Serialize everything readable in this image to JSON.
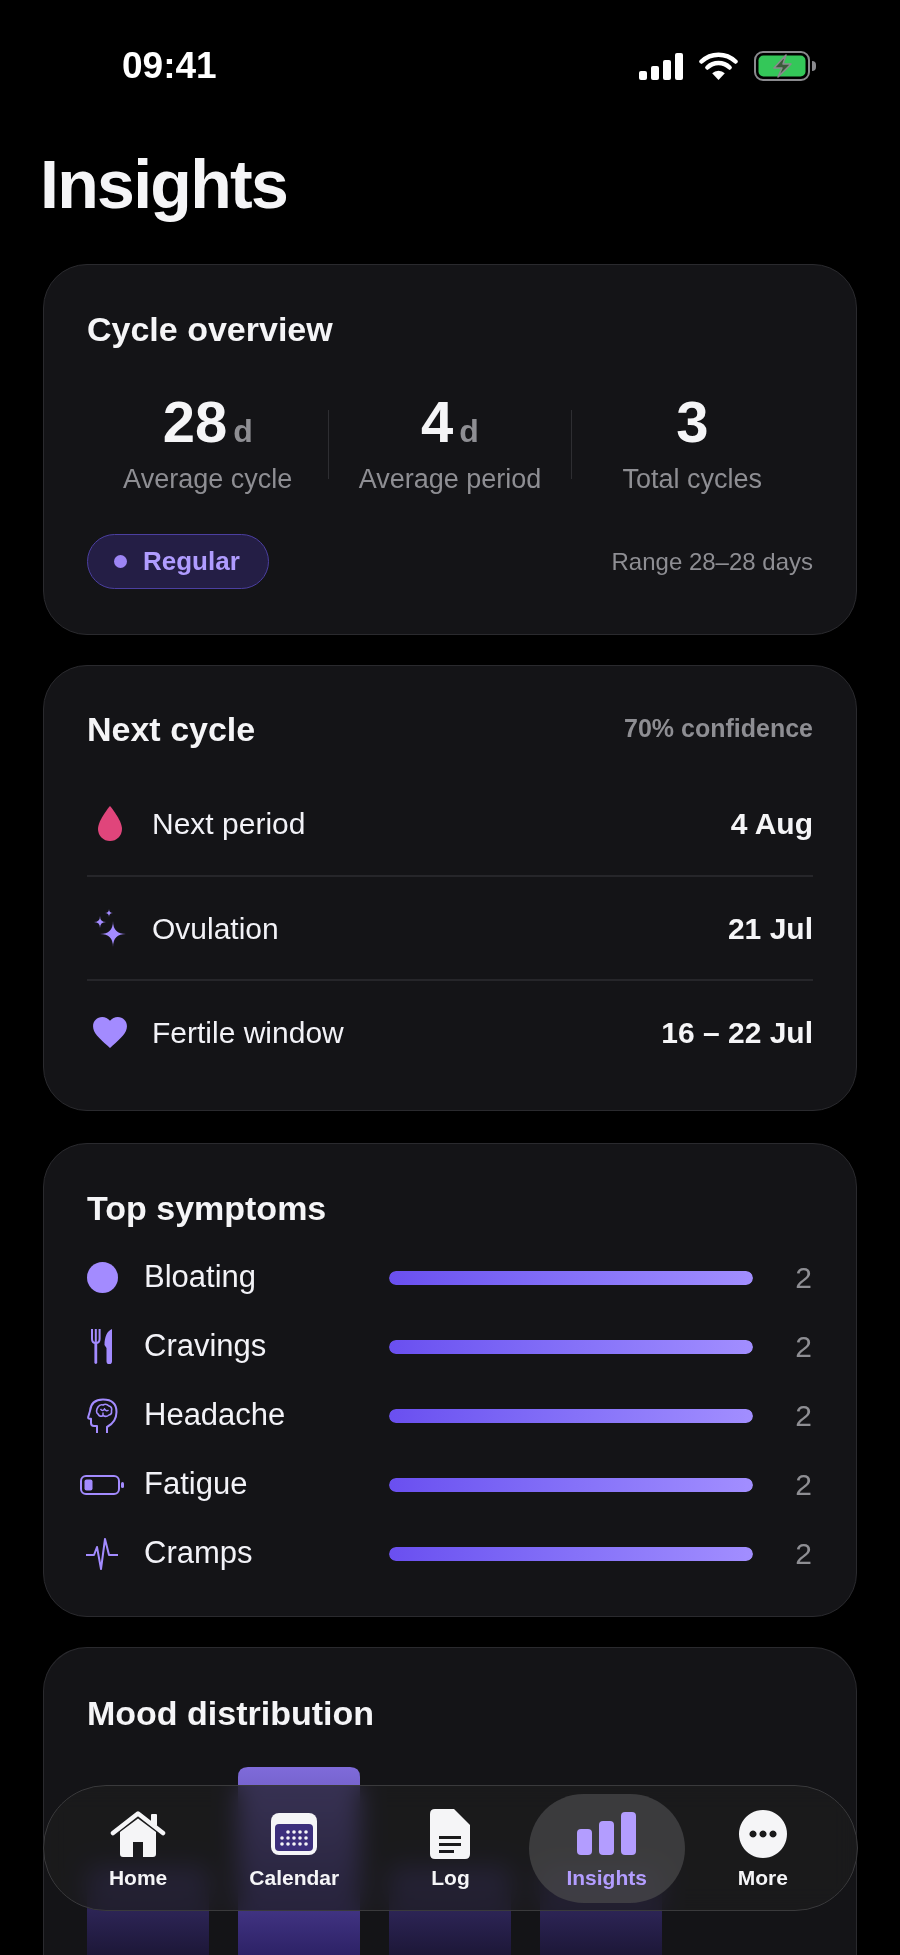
{
  "status_bar": {
    "time": "09:41"
  },
  "title": "Insights",
  "cycle_overview": {
    "title": "Cycle overview",
    "stats": [
      {
        "value": "28",
        "unit": "d",
        "label": "Average cycle"
      },
      {
        "value": "4",
        "unit": "d",
        "label": "Average period"
      },
      {
        "value": "3",
        "label": "Total cycles"
      }
    ],
    "badge": "Regular",
    "range": "Range 28–28 days"
  },
  "next_cycle": {
    "title": "Next cycle",
    "confidence": "70% confidence",
    "rows": [
      {
        "label": "Next period",
        "value": "4 Aug"
      },
      {
        "label": "Ovulation",
        "value": "21 Jul"
      },
      {
        "label": "Fertile window",
        "value": "16 – 22 Jul"
      }
    ]
  },
  "top_symptoms": {
    "title": "Top symptoms",
    "items": [
      {
        "label": "Bloating",
        "level": 1,
        "count": "2"
      },
      {
        "label": "Cravings",
        "level": 1,
        "count": "2"
      },
      {
        "label": "Headache",
        "level": 1,
        "count": "2"
      },
      {
        "label": "Fatigue",
        "level": 1,
        "count": "2"
      },
      {
        "label": "Cramps",
        "level": 1,
        "count": "2"
      }
    ]
  },
  "mood_distribution": {
    "title": "Mood distribution"
  },
  "tab_bar": {
    "tabs": [
      {
        "label": "Home",
        "selected": false
      },
      {
        "label": "Calendar",
        "selected": false
      },
      {
        "label": "Log",
        "selected": false
      },
      {
        "label": "Insights",
        "selected": true
      },
      {
        "label": "More",
        "selected": false
      }
    ]
  }
}
